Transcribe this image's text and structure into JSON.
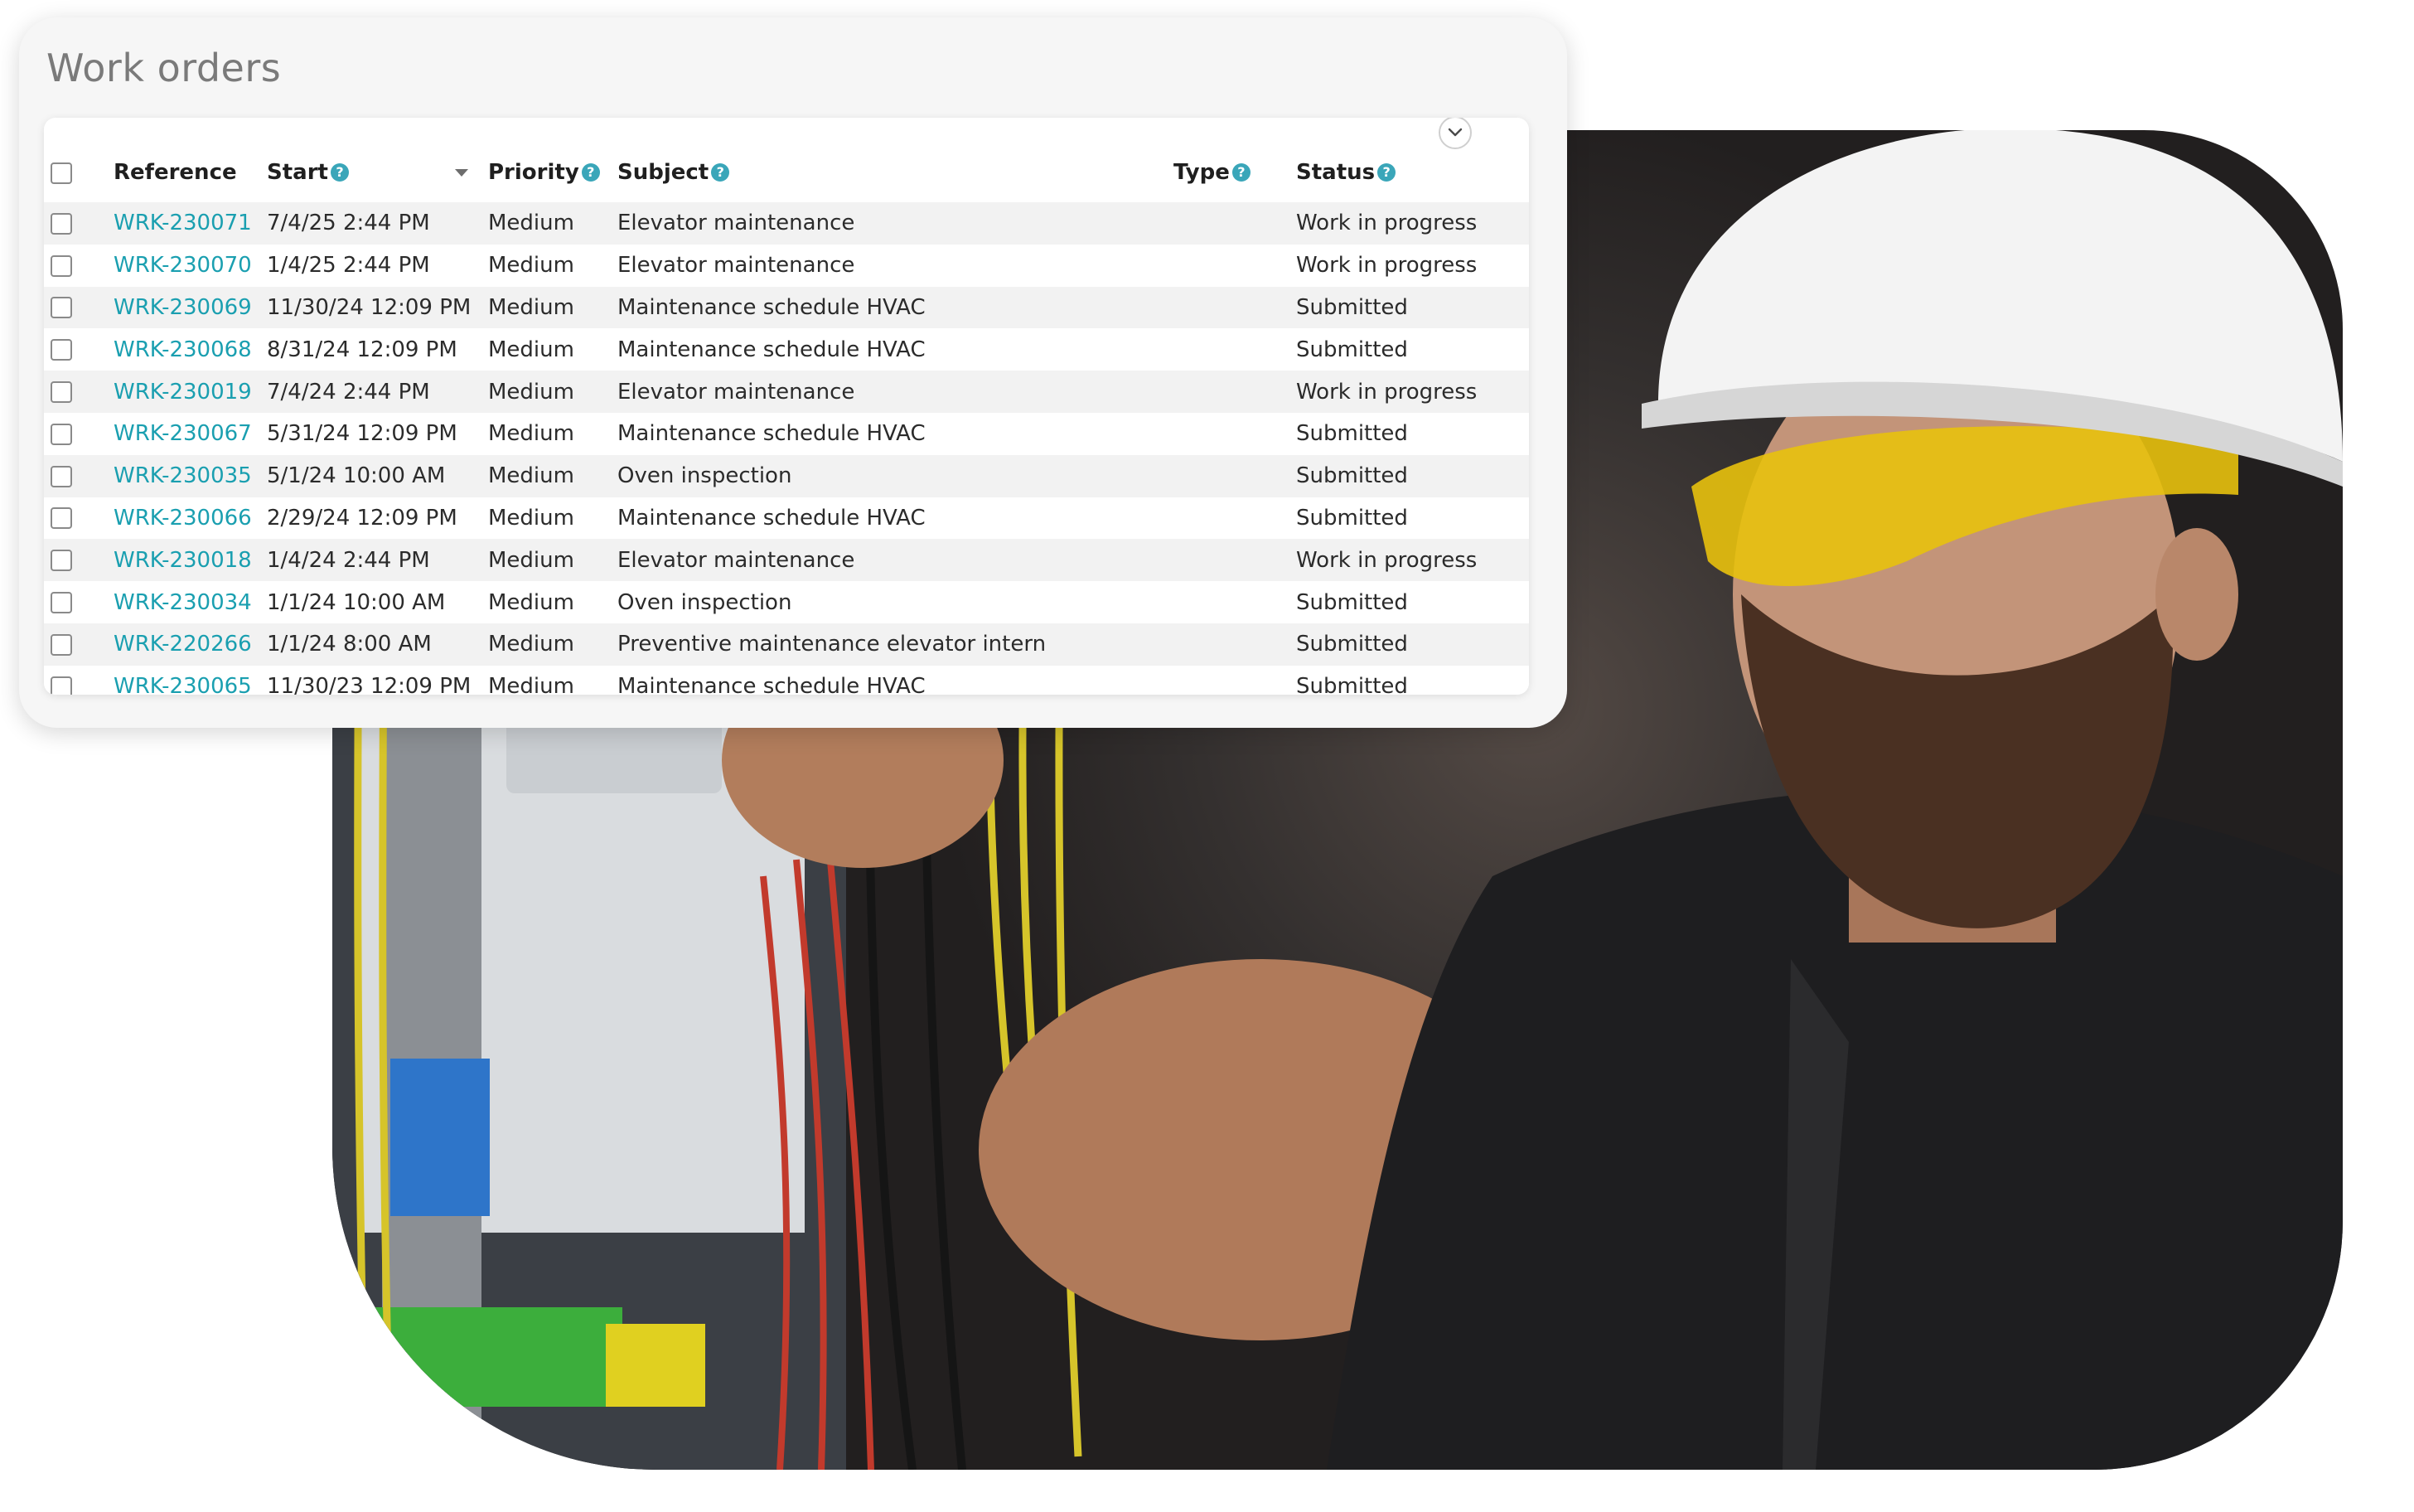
{
  "card": {
    "title": "Work orders"
  },
  "table": {
    "columns": {
      "reference": "Reference",
      "start": "Start",
      "priority": "Priority",
      "subject": "Subject",
      "type": "Type",
      "status": "Status"
    },
    "help_glyph": "?",
    "rows": [
      {
        "reference": "WRK-230071",
        "start": "7/4/25 2:44 PM",
        "priority": "Medium",
        "subject": "Elevator maintenance",
        "type": "",
        "status": "Work in progress"
      },
      {
        "reference": "WRK-230070",
        "start": "1/4/25 2:44 PM",
        "priority": "Medium",
        "subject": "Elevator maintenance",
        "type": "",
        "status": "Work in progress"
      },
      {
        "reference": "WRK-230069",
        "start": "11/30/24 12:09 PM",
        "priority": "Medium",
        "subject": "Maintenance schedule HVAC",
        "type": "",
        "status": "Submitted"
      },
      {
        "reference": "WRK-230068",
        "start": "8/31/24 12:09 PM",
        "priority": "Medium",
        "subject": "Maintenance schedule HVAC",
        "type": "",
        "status": "Submitted"
      },
      {
        "reference": "WRK-230019",
        "start": "7/4/24 2:44 PM",
        "priority": "Medium",
        "subject": "Elevator maintenance",
        "type": "",
        "status": "Work in progress"
      },
      {
        "reference": "WRK-230067",
        "start": "5/31/24 12:09 PM",
        "priority": "Medium",
        "subject": "Maintenance schedule HVAC",
        "type": "",
        "status": "Submitted"
      },
      {
        "reference": "WRK-230035",
        "start": "5/1/24 10:00 AM",
        "priority": "Medium",
        "subject": "Oven inspection",
        "type": "",
        "status": "Submitted"
      },
      {
        "reference": "WRK-230066",
        "start": "2/29/24 12:09 PM",
        "priority": "Medium",
        "subject": "Maintenance schedule HVAC",
        "type": "",
        "status": "Submitted"
      },
      {
        "reference": "WRK-230018",
        "start": "1/4/24 2:44 PM",
        "priority": "Medium",
        "subject": "Elevator maintenance",
        "type": "",
        "status": "Work in progress"
      },
      {
        "reference": "WRK-230034",
        "start": "1/1/24 10:00 AM",
        "priority": "Medium",
        "subject": "Oven inspection",
        "type": "",
        "status": "Submitted"
      },
      {
        "reference": "WRK-220266",
        "start": "1/1/24 8:00 AM",
        "priority": "Medium",
        "subject": "Preventive maintenance elevator intern",
        "type": "",
        "status": "Submitted"
      },
      {
        "reference": "WRK-230065",
        "start": "11/30/23 12:09 PM",
        "priority": "Medium",
        "subject": "Maintenance schedule HVAC",
        "type": "",
        "status": "Submitted"
      }
    ]
  },
  "icons": {
    "collapse": "chevron-down-icon",
    "sort": "sort-descending-icon",
    "help": "help-circle-icon",
    "checkbox": "checkbox-icon"
  },
  "colors": {
    "link": "#1a9fb0",
    "help_badge": "#3aa6b9",
    "card_bg": "#f6f6f6",
    "row_stripe": "#f2f2f2"
  }
}
